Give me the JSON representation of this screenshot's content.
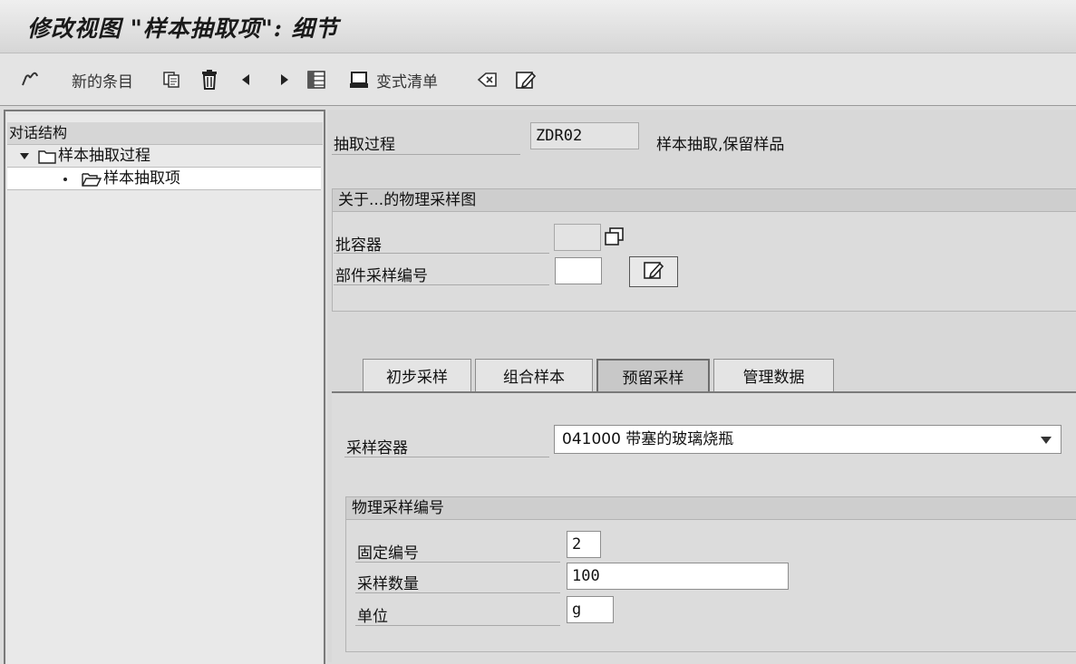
{
  "window": {
    "title": "修改视图 \"样本抽取项\": 细节"
  },
  "toolbar": {
    "new_entries_label": "新的条目",
    "variant_list_label": "变式清单",
    "icons": [
      "glasses-icon",
      "copy-icon",
      "delete-icon",
      "prev-icon",
      "next-icon",
      "select-all-icon",
      "print-icon",
      "undo-icon",
      "edit-icon"
    ]
  },
  "nav": {
    "header": "对话结构",
    "items": [
      {
        "label": "样本抽取过程",
        "level": 0,
        "expanded": true,
        "icon": "folder-icon"
      },
      {
        "label": "样本抽取项",
        "level": 1,
        "selected": true,
        "icon": "open-folder-icon"
      }
    ]
  },
  "form": {
    "procedure_label": "抽取过程",
    "procedure_value": "ZDR02",
    "procedure_desc": "样本抽取,保留样品",
    "physical_group": {
      "title": "关于...的物理采样图",
      "batch_container_label": "批容器",
      "batch_container_value": "",
      "part_number_label": "部件采样编号",
      "part_number_value": ""
    }
  },
  "tabs": [
    {
      "label": "初步采样",
      "active": false
    },
    {
      "label": "组合样本",
      "active": false
    },
    {
      "label": "预留采样",
      "active": true
    },
    {
      "label": "管理数据",
      "active": false
    }
  ],
  "tab_content": {
    "container_label": "采样容器",
    "container_value": "041000 带塞的玻璃烧瓶",
    "sample_group": {
      "title": "物理采样编号",
      "fixed_number_label": "固定编号",
      "fixed_number_value": "2",
      "quantity_label": "采样数量",
      "quantity_value": "100",
      "unit_label": "单位",
      "unit_value": "g"
    }
  }
}
